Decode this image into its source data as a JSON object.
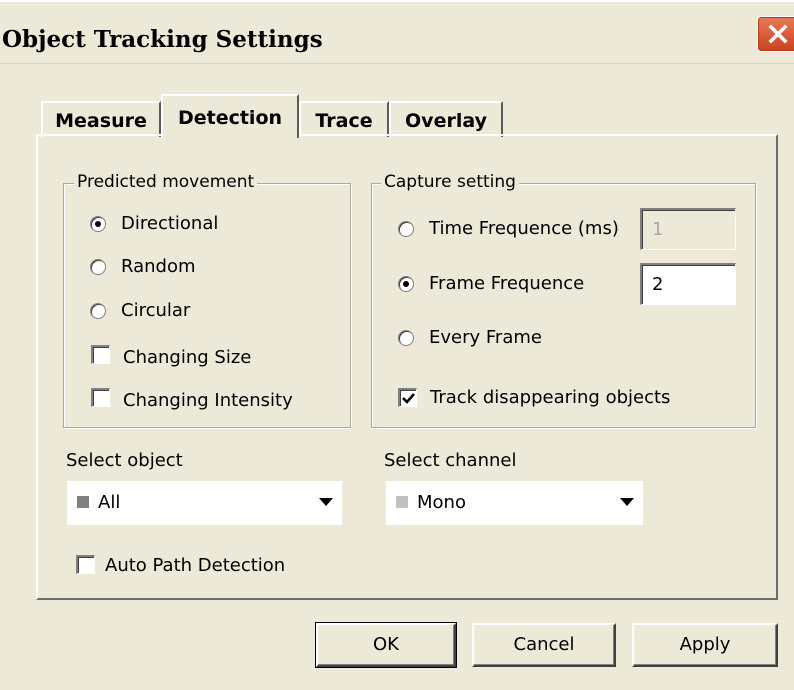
{
  "window": {
    "title": "Object Tracking Settings"
  },
  "tabs": [
    {
      "label": "Measure",
      "selected": false
    },
    {
      "label": "Detection",
      "selected": true
    },
    {
      "label": "Trace",
      "selected": false
    },
    {
      "label": "Overlay",
      "selected": false
    }
  ],
  "predicted_movement": {
    "legend": "Predicted movement",
    "options": [
      {
        "label": "Directional",
        "selected": true
      },
      {
        "label": "Random",
        "selected": false
      },
      {
        "label": "Circular",
        "selected": false
      }
    ],
    "changing_size": {
      "label": "Changing Size",
      "checked": false
    },
    "changing_intensity": {
      "label": "Changing Intensity",
      "checked": false
    }
  },
  "capture_setting": {
    "legend": "Capture setting",
    "time_frequence": {
      "label": "Time Frequence (ms)",
      "value": "1",
      "selected": false,
      "enabled": false
    },
    "frame_frequence": {
      "label": "Frame Frequence",
      "value": "2",
      "selected": true
    },
    "every_frame": {
      "label": "Every Frame",
      "selected": false
    },
    "track_disappearing": {
      "label": "Track disappearing objects",
      "checked": true
    }
  },
  "select_object": {
    "label": "Select object",
    "value": "All",
    "swatch_color": "#808080"
  },
  "select_channel": {
    "label": "Select channel",
    "value": "Mono",
    "swatch_color": "#c0c0c0"
  },
  "auto_path_detection": {
    "label": "Auto Path Detection",
    "checked": false
  },
  "buttons": {
    "ok": "OK",
    "cancel": "Cancel",
    "apply": "Apply"
  }
}
